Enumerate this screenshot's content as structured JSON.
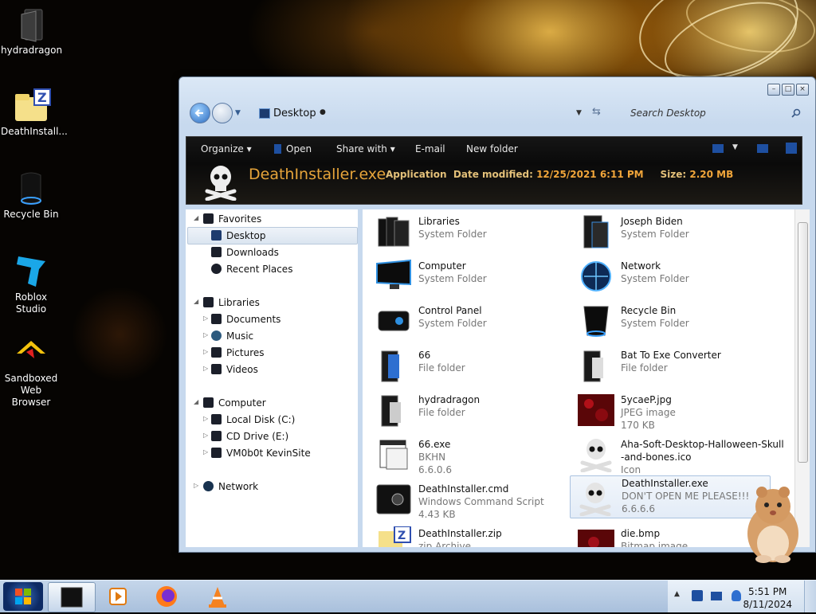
{
  "desktop": {
    "icons": [
      {
        "label": "hydradragon"
      },
      {
        "label": "DeathInstall..."
      },
      {
        "label": "Recycle Bin"
      },
      {
        "label": "Roblox Studio"
      },
      {
        "label": "Sandboxed Web Browser"
      }
    ]
  },
  "window": {
    "address": "Desktop",
    "search_placeholder": "Search Desktop",
    "toolbar": {
      "organize": "Organize",
      "open": "Open",
      "share_with": "Share with",
      "email": "E-mail",
      "new_folder": "New folder"
    },
    "details": {
      "name": "DeathInstaller.exe",
      "type": "Application",
      "date_label": "Date modified:",
      "date_value": "12/25/2021 6:11 PM",
      "size_label": "Size:",
      "size_value": "2.20 MB"
    },
    "nav": {
      "favorites": "Favorites",
      "desktop": "Desktop",
      "downloads": "Downloads",
      "recent": "Recent Places",
      "libraries": "Libraries",
      "documents": "Documents",
      "music": "Music",
      "pictures": "Pictures",
      "videos": "Videos",
      "computer": "Computer",
      "local_disk": "Local Disk (C:)",
      "cd_drive": "CD Drive (E:)",
      "vm": "VM0b0t KevinSite",
      "network": "Network"
    },
    "files": [
      {
        "name": "Libraries",
        "l2": "System Folder",
        "l3": ""
      },
      {
        "name": "Joseph Biden",
        "l2": "System Folder",
        "l3": ""
      },
      {
        "name": "Computer",
        "l2": "System Folder",
        "l3": ""
      },
      {
        "name": "Network",
        "l2": "System Folder",
        "l3": ""
      },
      {
        "name": "Control Panel",
        "l2": "System Folder",
        "l3": ""
      },
      {
        "name": "Recycle Bin",
        "l2": "System Folder",
        "l3": ""
      },
      {
        "name": "66",
        "l2": "File folder",
        "l3": ""
      },
      {
        "name": "Bat To Exe Converter",
        "l2": "File folder",
        "l3": ""
      },
      {
        "name": "hydradragon",
        "l2": "File folder",
        "l3": ""
      },
      {
        "name": "5ycaeP.jpg",
        "l2": "JPEG image",
        "l3": "170 KB"
      },
      {
        "name": "66.exe",
        "l2": "BKHN",
        "l3": "6.6.0.6"
      },
      {
        "name": "Aha-Soft-Desktop-Halloween-Skull",
        "l2": "-and-bones.ico",
        "l3": "Icon"
      },
      {
        "name": "DeathInstaller.cmd",
        "l2": "Windows Command Script",
        "l3": "4.43 KB"
      },
      {
        "name": "DeathInstaller.exe",
        "l2": "DON'T OPEN ME PLEASE!!!",
        "l3": "6.6.6.6"
      },
      {
        "name": "DeathInstaller.zip",
        "l2": "zip Archive",
        "l3": ""
      },
      {
        "name": "die.bmp",
        "l2": "Bitmap image",
        "l3": ""
      }
    ]
  },
  "taskbar": {
    "time": "5:51 PM",
    "date": "8/11/2024"
  },
  "icons": {
    "skull": "skull-crossbones-icon",
    "folder": "folder-icon",
    "search": "search-icon"
  }
}
